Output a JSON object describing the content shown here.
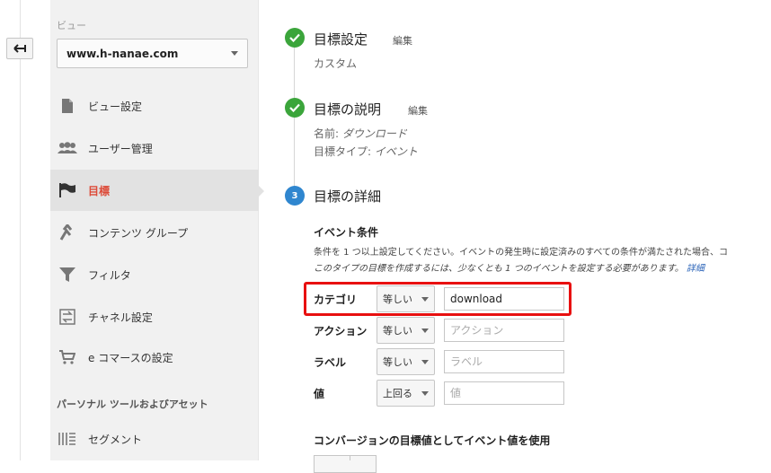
{
  "sidebar": {
    "view_label": "ビュー",
    "view_value": "www.h-nanae.com",
    "items": [
      {
        "label": "ビュー設定",
        "icon": "document-icon"
      },
      {
        "label": "ユーザー管理",
        "icon": "users-icon"
      },
      {
        "label": "目標",
        "icon": "flag-icon",
        "active": true
      },
      {
        "label": "コンテンツ グループ",
        "icon": "content-group-icon"
      },
      {
        "label": "フィルタ",
        "icon": "filter-icon"
      },
      {
        "label": "チャネル設定",
        "icon": "channel-icon"
      },
      {
        "label": "e コマースの設定",
        "icon": "cart-icon"
      }
    ],
    "section_personal": "パーソナル ツールおよびアセット",
    "segment_label": "セグメント"
  },
  "steps": {
    "step1": {
      "title": "目標設定",
      "edit": "編集",
      "sub": "カスタム"
    },
    "step2": {
      "title": "目標の説明",
      "edit": "編集",
      "name_label": "名前:",
      "name_value": "ダウンロード",
      "type_label": "目標タイプ:",
      "type_value": "イベント"
    },
    "step3": {
      "number": "3",
      "title": "目標の詳細"
    }
  },
  "event_conditions": {
    "title": "イベント条件",
    "desc1": "条件を 1 つ以上設定してください。イベントの発生時に設定済みのすべての条件が満たされた場合、コ",
    "desc2": "このタイプの目標を作成するには、少なくとも 1 つのイベントを設定する必要があります。",
    "desc2_link": "詳細",
    "rows": [
      {
        "label": "カテゴリ",
        "operator": "等しい",
        "value": "download",
        "placeholder": ""
      },
      {
        "label": "アクション",
        "operator": "等しい",
        "value": "",
        "placeholder": "アクション"
      },
      {
        "label": "ラベル",
        "operator": "等しい",
        "value": "",
        "placeholder": "ラベル"
      },
      {
        "label": "値",
        "operator": "上回る",
        "value": "",
        "placeholder": "値"
      }
    ]
  },
  "conversion_value_title": "コンバージョンの目標値としてイベント値を使用",
  "colors": {
    "accent_active": "#dd4b39",
    "step_done": "#3ba53b",
    "step_current": "#2f86cf",
    "highlight": "#e81010"
  }
}
